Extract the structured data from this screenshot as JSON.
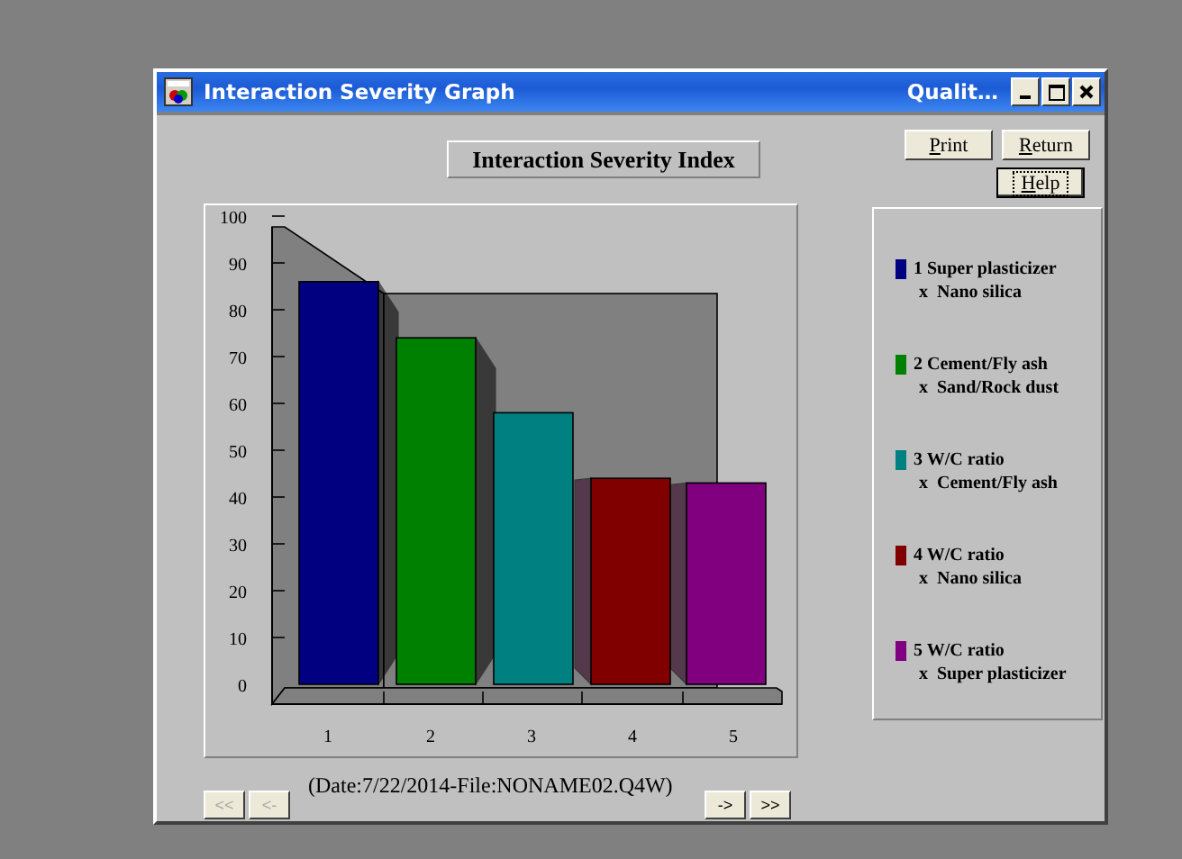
{
  "window": {
    "title": "Interaction Severity Graph",
    "subtitle": "Qualit…"
  },
  "buttons": [
    {
      "label": "Print",
      "focused": false
    },
    {
      "label": "Return",
      "focused": false
    },
    {
      "label": "Help",
      "focused": true
    }
  ],
  "chart": {
    "title": "Interaction Severity Index",
    "chart_data": {
      "type": "bar",
      "categories": [
        "1",
        "2",
        "3",
        "4",
        "5"
      ],
      "series": [
        {
          "values": [
            86,
            74,
            58,
            44,
            43
          ]
        }
      ],
      "ylim": [
        0,
        100
      ],
      "yticks": [
        0,
        10,
        20,
        30,
        40,
        50,
        60,
        70,
        80,
        90,
        100
      ]
    }
  },
  "legend": {
    "items": [
      {
        "number": "1",
        "first": "Super plasticizer",
        "second": "x  Nano silica",
        "color": "#000080"
      },
      {
        "number": "2",
        "first": "Cement/Fly ash",
        "second": "x  Sand/Rock dust",
        "color": "#008000"
      },
      {
        "number": "3",
        "first": "W/C ratio",
        "second": "x  Cement/Fly ash",
        "color": "#008080"
      },
      {
        "number": "4",
        "first": "W/C ratio",
        "second": "x  Nano silica",
        "color": "#800000"
      },
      {
        "number": "5",
        "first": "W/C ratio",
        "second": "x  Super plasticizer",
        "color": "#800080"
      }
    ]
  },
  "footer": {
    "text": "(Date:7/22/2014-File:NONAME02.Q4W)"
  },
  "navigation": [
    {
      "label": "<<",
      "disabled": true
    },
    {
      "label": "<-",
      "disabled": true
    },
    {
      "label": "->",
      "disabled": false
    },
    {
      "label": ">>",
      "disabled": false
    }
  ]
}
